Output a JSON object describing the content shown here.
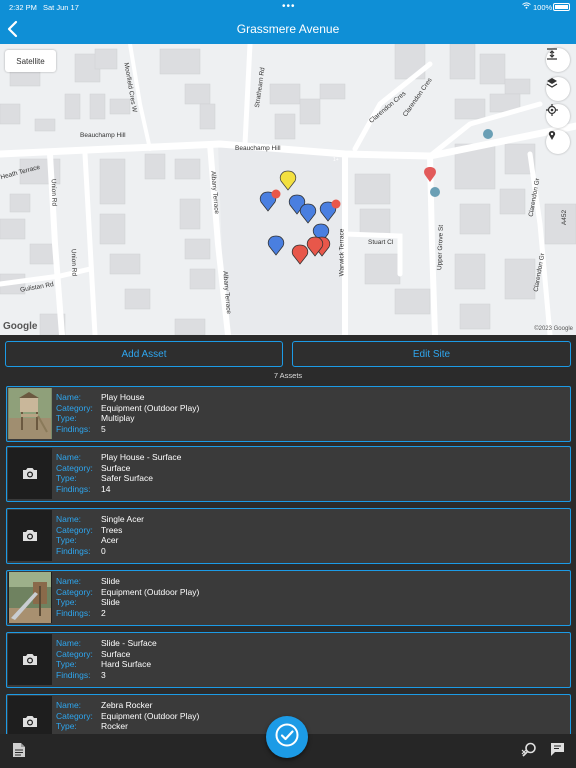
{
  "status": {
    "time": "2:32 PM",
    "date": "Sat Jun 17",
    "battery": "100%"
  },
  "nav": {
    "title": "Grassmere Avenue"
  },
  "map": {
    "satellite_label": "Satellite",
    "google_label": "Google",
    "copyright": "©2023 Google",
    "streets": [
      "Beauchamp Hill",
      "Beauchamp Hill",
      "Union Rd",
      "Albany Terrace",
      "Albany Terrace",
      "Warwick Terrace",
      "Stuart Cl",
      "Upper Grove St",
      "Strathearn Rd",
      "Clarendon Cres",
      "Clarendon Cres",
      "Clarendon Gr",
      "Clarendon Gr",
      "Gulistan Rd",
      "Union Rd",
      "Moorfield Cres W",
      "A452",
      "Heath Terrace"
    ],
    "pin_badges": [
      "1+",
      "1+"
    ]
  },
  "actions": {
    "add_asset": "Add Asset",
    "edit_site": "Edit Site"
  },
  "asset_count": "7 Assets",
  "labels": {
    "name": "Name:",
    "category": "Category:",
    "type": "Type:",
    "findings": "Findings:"
  },
  "assets": [
    {
      "name": "Play House",
      "category": "Equipment (Outdoor Play)",
      "type": "Multiplay",
      "findings": "5",
      "thumb": "photo-playhouse"
    },
    {
      "name": "Play House - Surface",
      "category": "Surface",
      "type": "Safer Surface",
      "findings": "14",
      "thumb": "camera-icon"
    },
    {
      "name": "Single Acer",
      "category": "Trees",
      "type": "Acer",
      "findings": "0",
      "thumb": "camera-icon"
    },
    {
      "name": "Slide",
      "category": "Equipment (Outdoor Play)",
      "type": "Slide",
      "findings": "2",
      "thumb": "photo-slide"
    },
    {
      "name": "Slide - Surface",
      "category": "Surface",
      "type": "Hard Surface",
      "findings": "3",
      "thumb": "camera-icon"
    },
    {
      "name": "Zebra Rocker",
      "category": "Equipment (Outdoor Play)",
      "type": "Rocker",
      "findings": "",
      "thumb": "camera-icon"
    }
  ],
  "colors": {
    "accent": "#1c9be6",
    "nav": "#0f8fd6",
    "pin_blue": "#4a7fe0",
    "pin_red": "#e8574a",
    "pin_yellow": "#f3e040"
  }
}
